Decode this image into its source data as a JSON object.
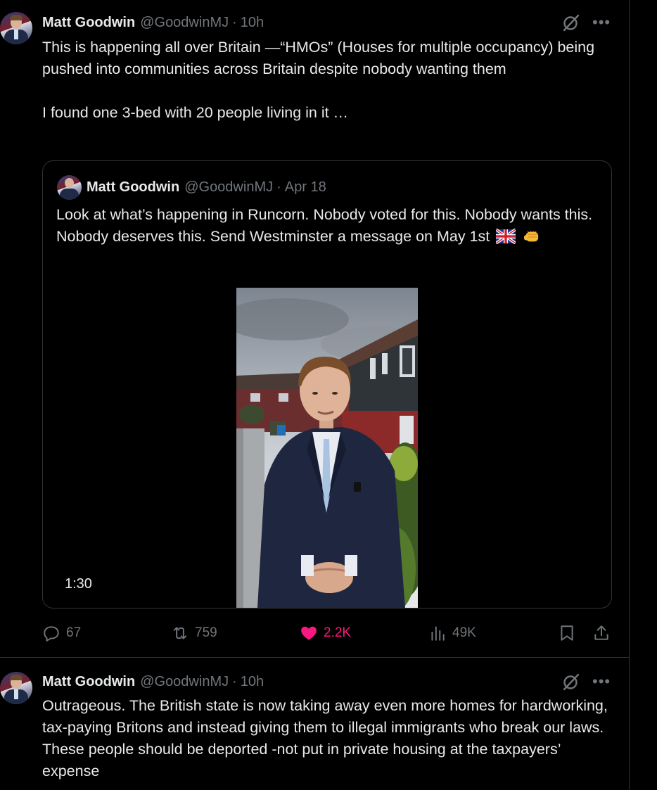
{
  "tweets": [
    {
      "name": "Matt Goodwin",
      "handle": "@GoodwinMJ",
      "dot": "·",
      "time": "10h",
      "text": "This is happening all over Britain —“HMOs” (Houses for multiple occupancy) being pushed into communities across Britain despite nobody wanting them\n\nI found one 3-bed with 20 people living in it …",
      "quoted": {
        "name": "Matt Goodwin",
        "handle": "@GoodwinMJ",
        "dot": "·",
        "time": "Apr 18",
        "text": "Look at what’s happening in Runcorn. Nobody voted for this. Nobody wants this. Nobody deserves this. Send Westminster a message on May 1st",
        "video_duration": "1:30"
      },
      "actions": {
        "replies": "67",
        "reposts": "759",
        "likes": "2.2K",
        "views": "49K"
      }
    },
    {
      "name": "Matt Goodwin",
      "handle": "@GoodwinMJ",
      "dot": "·",
      "time": "10h",
      "text": "Outrageous. The British state is now taking away even more homes for hardworking, tax-paying Britons and instead giving them to illegal immigrants who break our laws. These people should be deported -not put in private housing at the taxpayers’ expense"
    }
  ],
  "icons": {
    "reply": "reply-icon",
    "repost": "repost-icon",
    "like": "heart-icon",
    "views": "analytics-icon",
    "bookmark": "bookmark-icon",
    "share": "share-icon",
    "grok": "grok-icon",
    "more": "more-icon"
  },
  "colors": {
    "background": "#000000",
    "text": "#e7e9ea",
    "muted": "#71767b",
    "like": "#f91880",
    "border": "#2f3336"
  }
}
